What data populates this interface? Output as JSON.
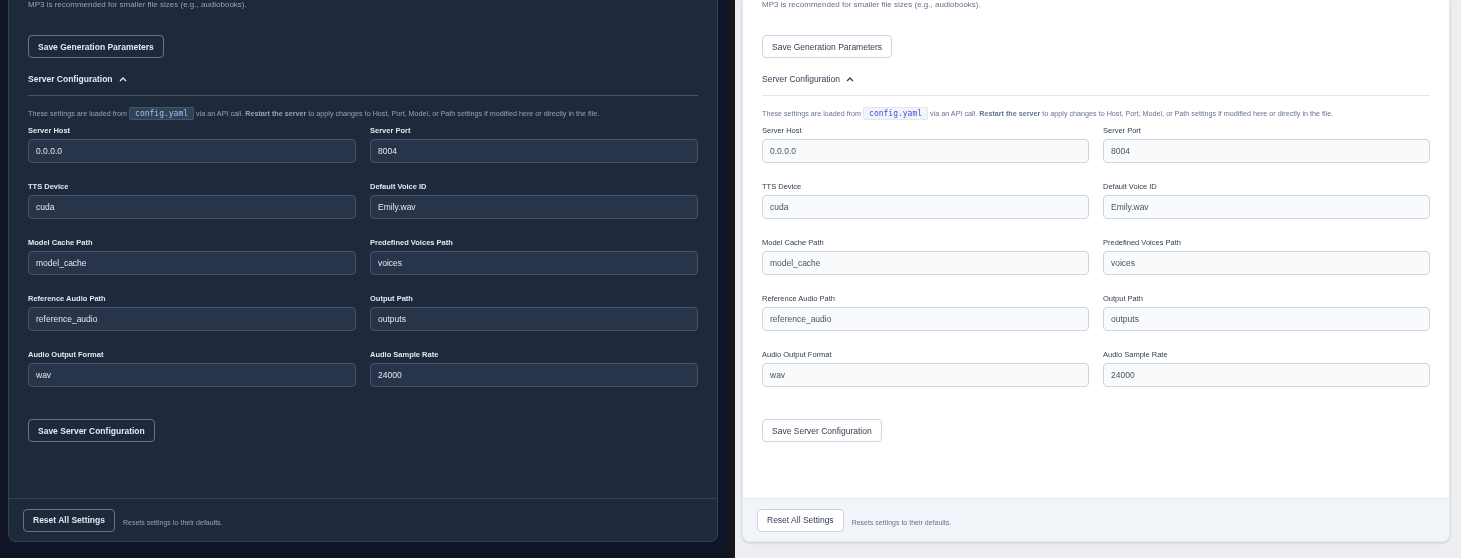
{
  "panels": [
    {
      "kind": "dark",
      "note": "MP3 is recommended for smaller file sizes (e.g., audiobooks).",
      "save_generation_button": "Save Generation Parameters",
      "section": {
        "title": "Server Configuration",
        "expanded": true
      },
      "info": {
        "before": "These settings are loaded from",
        "code": "config.yaml",
        "after": "via an API call. **Restart the server** to apply changes to Host, Port, Model, or Path settings if modified here or directly in the file."
      },
      "fields": [
        {
          "label": "Server Host",
          "value": "0.0.0.0"
        },
        {
          "label": "Server Port",
          "value": "8004"
        },
        {
          "label": "TTS Device",
          "value": "cuda"
        },
        {
          "label": "Default Voice ID",
          "value": "Emily.wav"
        },
        {
          "label": "Model Cache Path",
          "value": "model_cache"
        },
        {
          "label": "Predefined Voices Path",
          "value": "voices"
        },
        {
          "label": "Reference Audio Path",
          "value": "reference_audio"
        },
        {
          "label": "Output Path",
          "value": "outputs"
        },
        {
          "label": "Audio Output Format",
          "value": "wav"
        },
        {
          "label": "Audio Sample Rate",
          "value": "24000"
        }
      ],
      "save_server_button": "Save Server Configuration",
      "reset_button": "Reset All Settings",
      "reset_hint": "Resets settings to their defaults."
    },
    {
      "kind": "light",
      "note": "MP3 is recommended for smaller file sizes (e.g., audiobooks).",
      "save_generation_button": "Save Generation Parameters",
      "section": {
        "title": "Server Configuration",
        "expanded": true
      },
      "info": {
        "before": "These settings are loaded from",
        "code": "config.yaml",
        "after": "via an API call. **Restart the server** to apply changes to Host, Port, Model, or Path settings if modified here or directly in the file."
      },
      "fields": [
        {
          "label": "Server Host",
          "value": "0.0.0.0"
        },
        {
          "label": "Server Port",
          "value": "8004"
        },
        {
          "label": "TTS Device",
          "value": "cuda"
        },
        {
          "label": "Default Voice ID",
          "value": "Emily.wav"
        },
        {
          "label": "Model Cache Path",
          "value": "model_cache"
        },
        {
          "label": "Predefined Voices Path",
          "value": "voices"
        },
        {
          "label": "Reference Audio Path",
          "value": "reference_audio"
        },
        {
          "label": "Output Path",
          "value": "outputs"
        },
        {
          "label": "Audio Output Format",
          "value": "wav"
        },
        {
          "label": "Audio Sample Rate",
          "value": "24000"
        }
      ],
      "save_server_button": "Save Server Configuration",
      "reset_button": "Reset All Settings",
      "reset_hint": "Resets settings to their defaults."
    }
  ]
}
